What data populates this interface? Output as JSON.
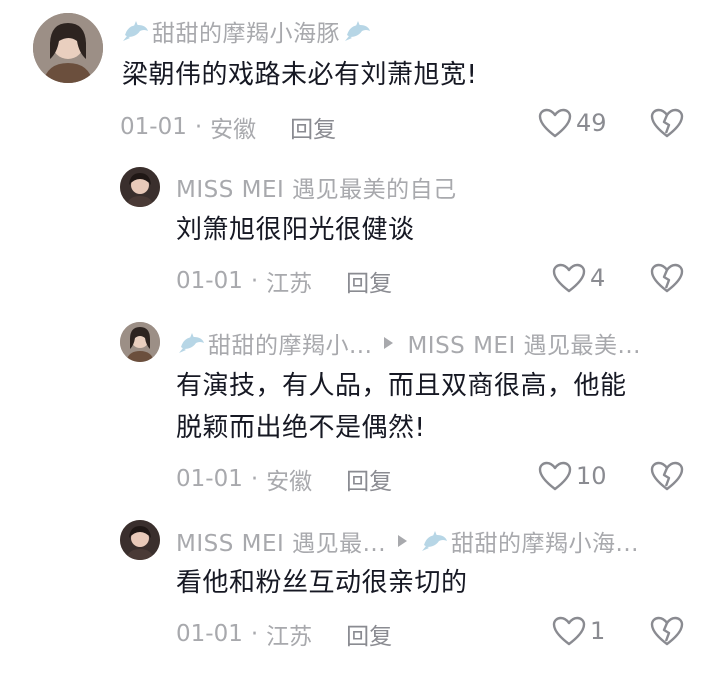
{
  "comments": [
    {
      "username": "甜甜的摩羯小海豚",
      "text": "梁朝伟的戏路未必有刘萧旭宽!",
      "date": "01-01",
      "location": "安徽",
      "reply_label": "回复",
      "likes": "49"
    },
    {
      "username": "MISS MEI 遇见最美的自己",
      "text": "刘箫旭很阳光很健谈",
      "date": "01-01",
      "location": "江苏",
      "reply_label": "回复",
      "likes": "4"
    },
    {
      "username": "甜甜的摩羯小...",
      "reply_to": "MISS MEI 遇见最美...",
      "text_line1": "有演技，有人品，而且双商很高，他能",
      "text_line2": "脱颖而出绝不是偶然!",
      "date": "01-01",
      "location": "安徽",
      "reply_label": "回复",
      "likes": "10"
    },
    {
      "username": "MISS MEI 遇见最...",
      "reply_to": "甜甜的摩羯小海...",
      "text": "看他和粉丝互动很亲切的",
      "date": "01-01",
      "location": "江苏",
      "reply_label": "回复",
      "likes": "1"
    }
  ],
  "separator": "·",
  "icons": {
    "like": "heart-outline-icon",
    "dislike": "broken-heart-icon",
    "badge": "dolphin-icon",
    "reply_to": "triangle-arrow-icon"
  },
  "colors": {
    "text": "#161823",
    "meta": "#a8a9ad",
    "badge": "#b7d6e6"
  }
}
